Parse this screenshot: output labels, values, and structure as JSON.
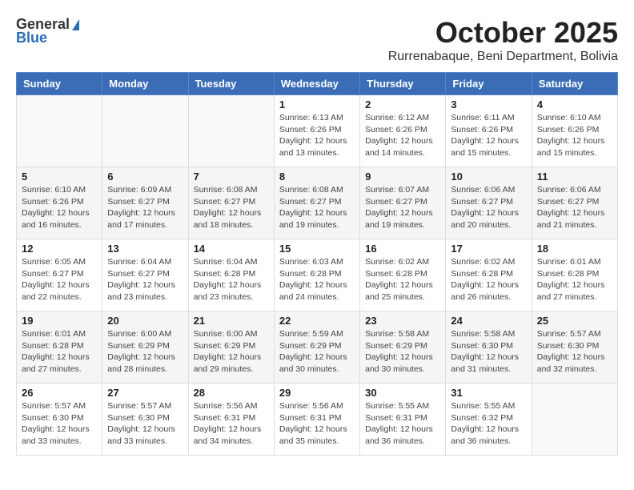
{
  "logo": {
    "general": "General",
    "blue": "Blue"
  },
  "title": "October 2025",
  "location": "Rurrenabaque, Beni Department, Bolivia",
  "weekdays": [
    "Sunday",
    "Monday",
    "Tuesday",
    "Wednesday",
    "Thursday",
    "Friday",
    "Saturday"
  ],
  "weeks": [
    [
      {
        "day": "",
        "info": ""
      },
      {
        "day": "",
        "info": ""
      },
      {
        "day": "",
        "info": ""
      },
      {
        "day": "1",
        "info": "Sunrise: 6:13 AM\nSunset: 6:26 PM\nDaylight: 12 hours\nand 13 minutes."
      },
      {
        "day": "2",
        "info": "Sunrise: 6:12 AM\nSunset: 6:26 PM\nDaylight: 12 hours\nand 14 minutes."
      },
      {
        "day": "3",
        "info": "Sunrise: 6:11 AM\nSunset: 6:26 PM\nDaylight: 12 hours\nand 15 minutes."
      },
      {
        "day": "4",
        "info": "Sunrise: 6:10 AM\nSunset: 6:26 PM\nDaylight: 12 hours\nand 15 minutes."
      }
    ],
    [
      {
        "day": "5",
        "info": "Sunrise: 6:10 AM\nSunset: 6:26 PM\nDaylight: 12 hours\nand 16 minutes."
      },
      {
        "day": "6",
        "info": "Sunrise: 6:09 AM\nSunset: 6:27 PM\nDaylight: 12 hours\nand 17 minutes."
      },
      {
        "day": "7",
        "info": "Sunrise: 6:08 AM\nSunset: 6:27 PM\nDaylight: 12 hours\nand 18 minutes."
      },
      {
        "day": "8",
        "info": "Sunrise: 6:08 AM\nSunset: 6:27 PM\nDaylight: 12 hours\nand 19 minutes."
      },
      {
        "day": "9",
        "info": "Sunrise: 6:07 AM\nSunset: 6:27 PM\nDaylight: 12 hours\nand 19 minutes."
      },
      {
        "day": "10",
        "info": "Sunrise: 6:06 AM\nSunset: 6:27 PM\nDaylight: 12 hours\nand 20 minutes."
      },
      {
        "day": "11",
        "info": "Sunrise: 6:06 AM\nSunset: 6:27 PM\nDaylight: 12 hours\nand 21 minutes."
      }
    ],
    [
      {
        "day": "12",
        "info": "Sunrise: 6:05 AM\nSunset: 6:27 PM\nDaylight: 12 hours\nand 22 minutes."
      },
      {
        "day": "13",
        "info": "Sunrise: 6:04 AM\nSunset: 6:27 PM\nDaylight: 12 hours\nand 23 minutes."
      },
      {
        "day": "14",
        "info": "Sunrise: 6:04 AM\nSunset: 6:28 PM\nDaylight: 12 hours\nand 23 minutes."
      },
      {
        "day": "15",
        "info": "Sunrise: 6:03 AM\nSunset: 6:28 PM\nDaylight: 12 hours\nand 24 minutes."
      },
      {
        "day": "16",
        "info": "Sunrise: 6:02 AM\nSunset: 6:28 PM\nDaylight: 12 hours\nand 25 minutes."
      },
      {
        "day": "17",
        "info": "Sunrise: 6:02 AM\nSunset: 6:28 PM\nDaylight: 12 hours\nand 26 minutes."
      },
      {
        "day": "18",
        "info": "Sunrise: 6:01 AM\nSunset: 6:28 PM\nDaylight: 12 hours\nand 27 minutes."
      }
    ],
    [
      {
        "day": "19",
        "info": "Sunrise: 6:01 AM\nSunset: 6:28 PM\nDaylight: 12 hours\nand 27 minutes."
      },
      {
        "day": "20",
        "info": "Sunrise: 6:00 AM\nSunset: 6:29 PM\nDaylight: 12 hours\nand 28 minutes."
      },
      {
        "day": "21",
        "info": "Sunrise: 6:00 AM\nSunset: 6:29 PM\nDaylight: 12 hours\nand 29 minutes."
      },
      {
        "day": "22",
        "info": "Sunrise: 5:59 AM\nSunset: 6:29 PM\nDaylight: 12 hours\nand 30 minutes."
      },
      {
        "day": "23",
        "info": "Sunrise: 5:58 AM\nSunset: 6:29 PM\nDaylight: 12 hours\nand 30 minutes."
      },
      {
        "day": "24",
        "info": "Sunrise: 5:58 AM\nSunset: 6:30 PM\nDaylight: 12 hours\nand 31 minutes."
      },
      {
        "day": "25",
        "info": "Sunrise: 5:57 AM\nSunset: 6:30 PM\nDaylight: 12 hours\nand 32 minutes."
      }
    ],
    [
      {
        "day": "26",
        "info": "Sunrise: 5:57 AM\nSunset: 6:30 PM\nDaylight: 12 hours\nand 33 minutes."
      },
      {
        "day": "27",
        "info": "Sunrise: 5:57 AM\nSunset: 6:30 PM\nDaylight: 12 hours\nand 33 minutes."
      },
      {
        "day": "28",
        "info": "Sunrise: 5:56 AM\nSunset: 6:31 PM\nDaylight: 12 hours\nand 34 minutes."
      },
      {
        "day": "29",
        "info": "Sunrise: 5:56 AM\nSunset: 6:31 PM\nDaylight: 12 hours\nand 35 minutes."
      },
      {
        "day": "30",
        "info": "Sunrise: 5:55 AM\nSunset: 6:31 PM\nDaylight: 12 hours\nand 36 minutes."
      },
      {
        "day": "31",
        "info": "Sunrise: 5:55 AM\nSunset: 6:32 PM\nDaylight: 12 hours\nand 36 minutes."
      },
      {
        "day": "",
        "info": ""
      }
    ]
  ]
}
